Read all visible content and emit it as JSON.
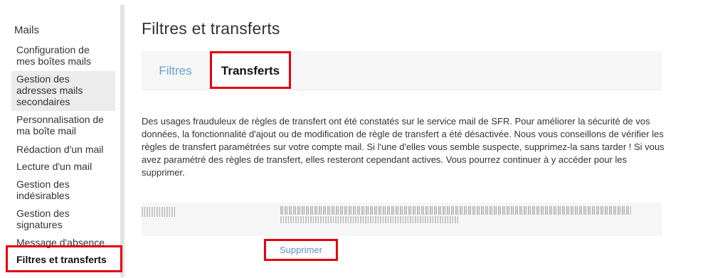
{
  "sidebar": {
    "title": "Mails",
    "items": [
      {
        "label_lines": [
          "Configuration de",
          "mes boîtes mails"
        ]
      },
      {
        "label_lines": [
          "Gestion des",
          "adresses mails",
          "secondaires"
        ]
      },
      {
        "label_lines": [
          "Personnalisation de",
          "ma boîte mail"
        ]
      },
      {
        "label_lines": [
          "Rédaction d'un mail"
        ]
      },
      {
        "label_lines": [
          "Lecture d'un mail"
        ]
      },
      {
        "label_lines": [
          "Gestion des",
          "indésirables"
        ]
      },
      {
        "label_lines": [
          "Gestion des",
          "signatures"
        ]
      },
      {
        "label_lines": [
          "Message d'absence"
        ]
      },
      {
        "label_lines": [
          "Filtres et transferts"
        ]
      }
    ]
  },
  "main": {
    "title": "Filtres et transferts",
    "tabs": [
      {
        "label": "Filtres"
      },
      {
        "label": "Transferts"
      }
    ],
    "notice": "Des usages frauduleux de règles de transfert ont été constatés sur le service mail de SFR. Pour améliorer la sécurité de vos données, la fonctionnalité d'ajout ou de modification de règle de transfert a été désactivée. Nous vous conseillons de vérifier les règles de transfert paramétrées sur votre compte mail. Si l'une d'elles vous semble suspecte, supprimez-la sans tarder ! Si vous avez paramétré des règles de transfert, elles resteront cependant actives. Vous pourrez continuer à y accéder pour les supprimer.",
    "delete_label": "Supprimer"
  },
  "colors": {
    "highlight_red": "#e3000f",
    "link_blue": "#5a8fcb",
    "tab_inactive": "#6b9fd1"
  }
}
